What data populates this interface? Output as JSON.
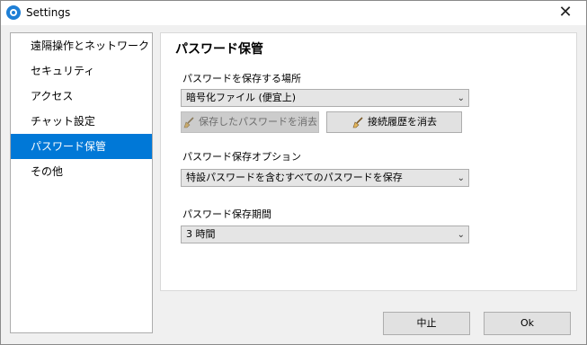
{
  "window": {
    "title": "Settings",
    "close_glyph": "✕"
  },
  "sidebar": {
    "items": [
      {
        "label": "遠隔操作とネットワーク"
      },
      {
        "label": "セキュリティ"
      },
      {
        "label": "アクセス"
      },
      {
        "label": "チャット設定"
      },
      {
        "label": "パスワード保管",
        "selected": true
      },
      {
        "label": "その他"
      }
    ]
  },
  "panel": {
    "title": "パスワード保管",
    "storage": {
      "label": "パスワードを保存する場所",
      "value": "暗号化ファイル (便宜上)",
      "clear_saved_label": "保存したパスワードを消去",
      "clear_history_label": "接続履歴を消去"
    },
    "options": {
      "label": "パスワード保存オプション",
      "value": "特設パスワードを含むすべてのパスワードを保存"
    },
    "period": {
      "label": "パスワード保存期間",
      "value": "3 時間"
    },
    "chevron_glyph": "⌄"
  },
  "footer": {
    "cancel_label": "中止",
    "ok_label": "Ok"
  }
}
